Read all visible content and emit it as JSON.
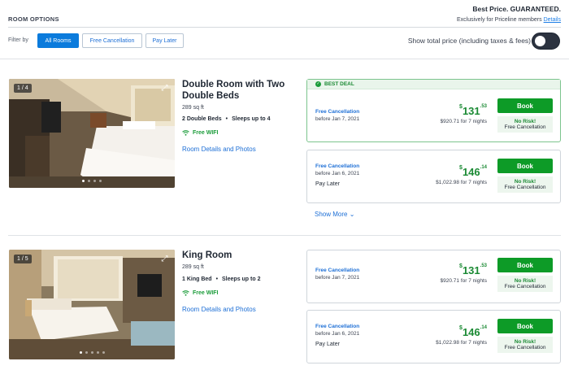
{
  "header": {
    "section_title": "ROOM OPTIONS",
    "best_price": "Best Price. GUARANTEED.",
    "exclusive_text": "Exclusively for Priceline members",
    "details_link": "Details"
  },
  "filters": {
    "label": "Filter by",
    "all_rooms": "All Rooms",
    "free_cancellation": "Free Cancellation",
    "pay_later": "Pay Later",
    "toggle_label": "Show total price (including taxes & fees)"
  },
  "rooms": [
    {
      "photo_count": "1 / 4",
      "name": "Double Room with Two Double Beds",
      "size": "289 sq ft",
      "beds": "2 Double Beds",
      "sleeps": "Sleeps up to 4",
      "wifi": "Free WIFI",
      "details": "Room Details and Photos",
      "show_more": "Show More",
      "rates": [
        {
          "badge": "BEST DEAL",
          "cancel": "Free Cancellation",
          "before": "before Jan 7, 2021",
          "currency": "$",
          "price_whole": "131",
          "price_cents": ".53",
          "total": "$920.71 for 7 nights",
          "book": "Book",
          "no_risk": "No Risk!",
          "no_risk_sub": "Free Cancellation"
        },
        {
          "cancel": "Free Cancellation",
          "before": "before Jan 6, 2021",
          "pay_later": "Pay Later",
          "currency": "$",
          "price_whole": "146",
          "price_cents": ".14",
          "total": "$1,022.98 for 7 nights",
          "book": "Book",
          "no_risk": "No Risk!",
          "no_risk_sub": "Free Cancellation"
        }
      ]
    },
    {
      "photo_count": "1 / 5",
      "name": "King Room",
      "size": "289 sq ft",
      "beds": "1 King Bed",
      "sleeps": "Sleeps up to 2",
      "wifi": "Free WIFI",
      "details": "Room Details and Photos",
      "rates": [
        {
          "cancel": "Free Cancellation",
          "before": "before Jan 7, 2021",
          "currency": "$",
          "price_whole": "131",
          "price_cents": ".53",
          "total": "$920.71 for 7 nights",
          "book": "Book",
          "no_risk": "No Risk!",
          "no_risk_sub": "Free Cancellation"
        },
        {
          "cancel": "Free Cancellation",
          "before": "before Jan 6, 2021",
          "pay_later": "Pay Later",
          "currency": "$",
          "price_whole": "146",
          "price_cents": ".14",
          "total": "$1,022.98 for 7 nights",
          "book": "Book",
          "no_risk": "No Risk!",
          "no_risk_sub": "Free Cancellation"
        }
      ]
    }
  ],
  "icons": {
    "expand": "expand-icon",
    "wifi": "wifi-icon",
    "chevron": "chevron-down-icon",
    "check": "check-circle-icon"
  },
  "colors": {
    "accent_blue": "#0b7bdc",
    "book_green": "#0d9b27",
    "price_green": "#1b8a34"
  }
}
